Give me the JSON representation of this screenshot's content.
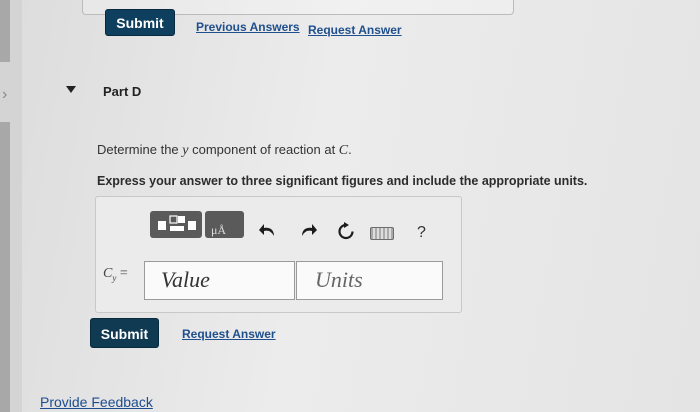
{
  "top_actions": {
    "submit_label": "Submit",
    "previous_answers_label": "Previous Answers",
    "request_answer_label": "Request Answer"
  },
  "part": {
    "title": "Part D",
    "question_prefix": "Determine the ",
    "question_var": "y",
    "question_mid": " component of reaction at ",
    "question_point": "C",
    "question_suffix": ".",
    "instruction": "Express your answer to three significant figures and include the appropriate units."
  },
  "toolbar": {
    "icons": [
      "templates-icon",
      "units-icon",
      "undo-icon",
      "redo-icon",
      "reset-icon",
      "keyboard-icon",
      "help-icon"
    ],
    "units_glyph": "μÅ",
    "help_glyph": "?"
  },
  "answer": {
    "label_var": "C",
    "label_sub": "y",
    "label_eq": " =",
    "value_placeholder": "Value",
    "units_placeholder": "Units"
  },
  "bottom_actions": {
    "submit_label": "Submit",
    "request_answer_label": "Request Answer"
  },
  "footer": {
    "feedback_label": "Provide Feedback"
  }
}
